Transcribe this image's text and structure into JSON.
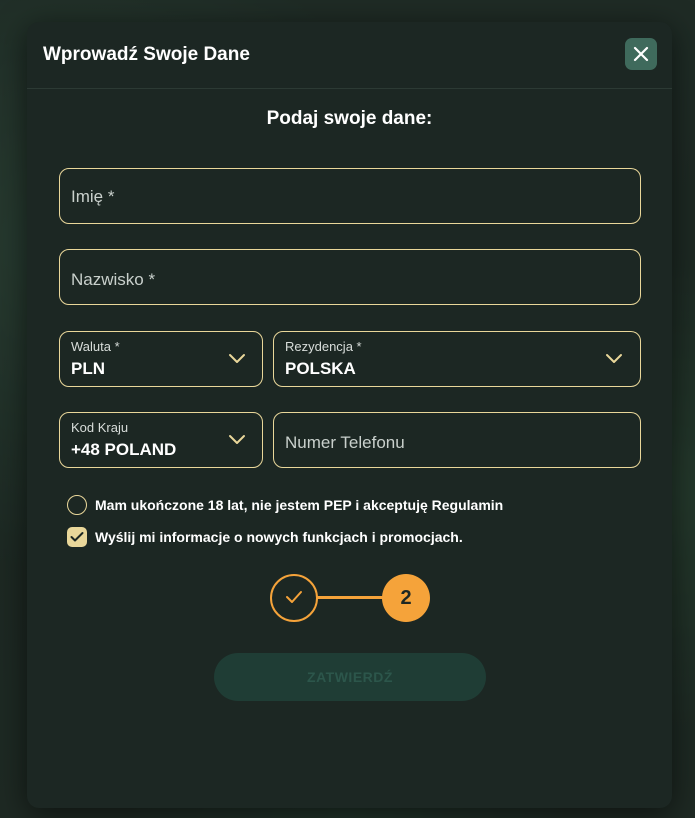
{
  "modal": {
    "title": "Wprowadź Swoje Dane",
    "close_icon": "close-icon",
    "subtitle": "Podaj swoje dane:"
  },
  "form": {
    "first_name": {
      "placeholder": "Imię *"
    },
    "last_name": {
      "placeholder": "Nazwisko *"
    },
    "currency": {
      "label": "Waluta *",
      "value": "PLN"
    },
    "residency": {
      "label": "Rezydencja *",
      "value": "POLSKA"
    },
    "country_code": {
      "label": "Kod Kraju",
      "value": "+48 POLAND"
    },
    "phone": {
      "placeholder": "Numer Telefonu"
    },
    "consents": [
      {
        "label": "Mam ukończone 18 lat, nie jestem PEP i akceptuję Regulamin",
        "checked": false
      },
      {
        "label": "Wyślij mi informacje o nowych funkcjach i promocjach.",
        "checked": true
      }
    ],
    "submit_label": "ZATWIERDŹ"
  },
  "stepper": {
    "completed_icon": "checkmark-icon",
    "current_step": "2"
  },
  "colors": {
    "accent_orange": "#f5a33a",
    "field_border": "#e9d79a",
    "modal_bg": "#1c2723",
    "close_button_bg": "#3f6a5c",
    "submit_disabled_bg": "#1f3d35"
  }
}
